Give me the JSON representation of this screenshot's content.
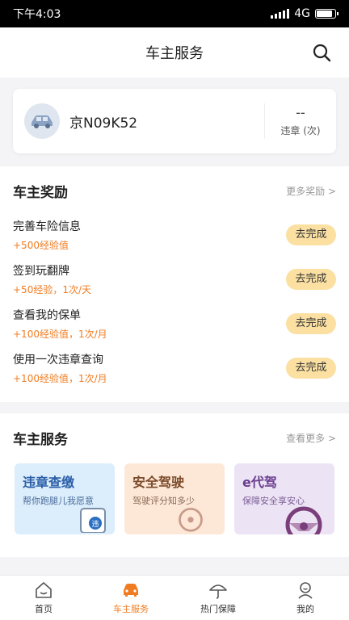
{
  "status": {
    "time": "下午4:03",
    "network": "4G"
  },
  "header": {
    "title": "车主服务"
  },
  "car": {
    "plate": "京N09K52",
    "violation_count": "--",
    "violation_label": "违章 (次)"
  },
  "rewards": {
    "title": "车主奖励",
    "more": "更多奖励 >",
    "tasks": [
      {
        "name": "完善车险信息",
        "desc": "+500经验值",
        "button": "去完成"
      },
      {
        "name": "签到玩翻牌",
        "desc": "+50经验，1次/天",
        "button": "去完成"
      },
      {
        "name": "查看我的保单",
        "desc": "+100经验值，1次/月",
        "button": "去完成"
      },
      {
        "name": "使用一次违章查询",
        "desc": "+100经验值，1次/月",
        "button": "去完成"
      }
    ]
  },
  "services": {
    "title": "车主服务",
    "more": "查看更多 >",
    "items": [
      {
        "title": "违章查缴",
        "subtitle": "帮你跑腿儿我愿意",
        "bg": "#dcedfb",
        "color": "#2b5fa8"
      },
      {
        "title": "安全驾驶",
        "subtitle": "驾驶评分知多少",
        "bg": "#fde8d8",
        "color": "#7a4a2a"
      },
      {
        "title": "e代驾",
        "subtitle": "保障安全享安心",
        "bg": "#ece3f5",
        "color": "#6b3e8f"
      }
    ]
  },
  "tabs": [
    {
      "label": "首页",
      "icon": "home-icon"
    },
    {
      "label": "车主服务",
      "icon": "car-icon"
    },
    {
      "label": "热门保障",
      "icon": "umbrella-icon"
    },
    {
      "label": "我的",
      "icon": "profile-icon"
    }
  ],
  "colors": {
    "accent": "#f07c22",
    "button_bg": "#fbe0a2"
  }
}
